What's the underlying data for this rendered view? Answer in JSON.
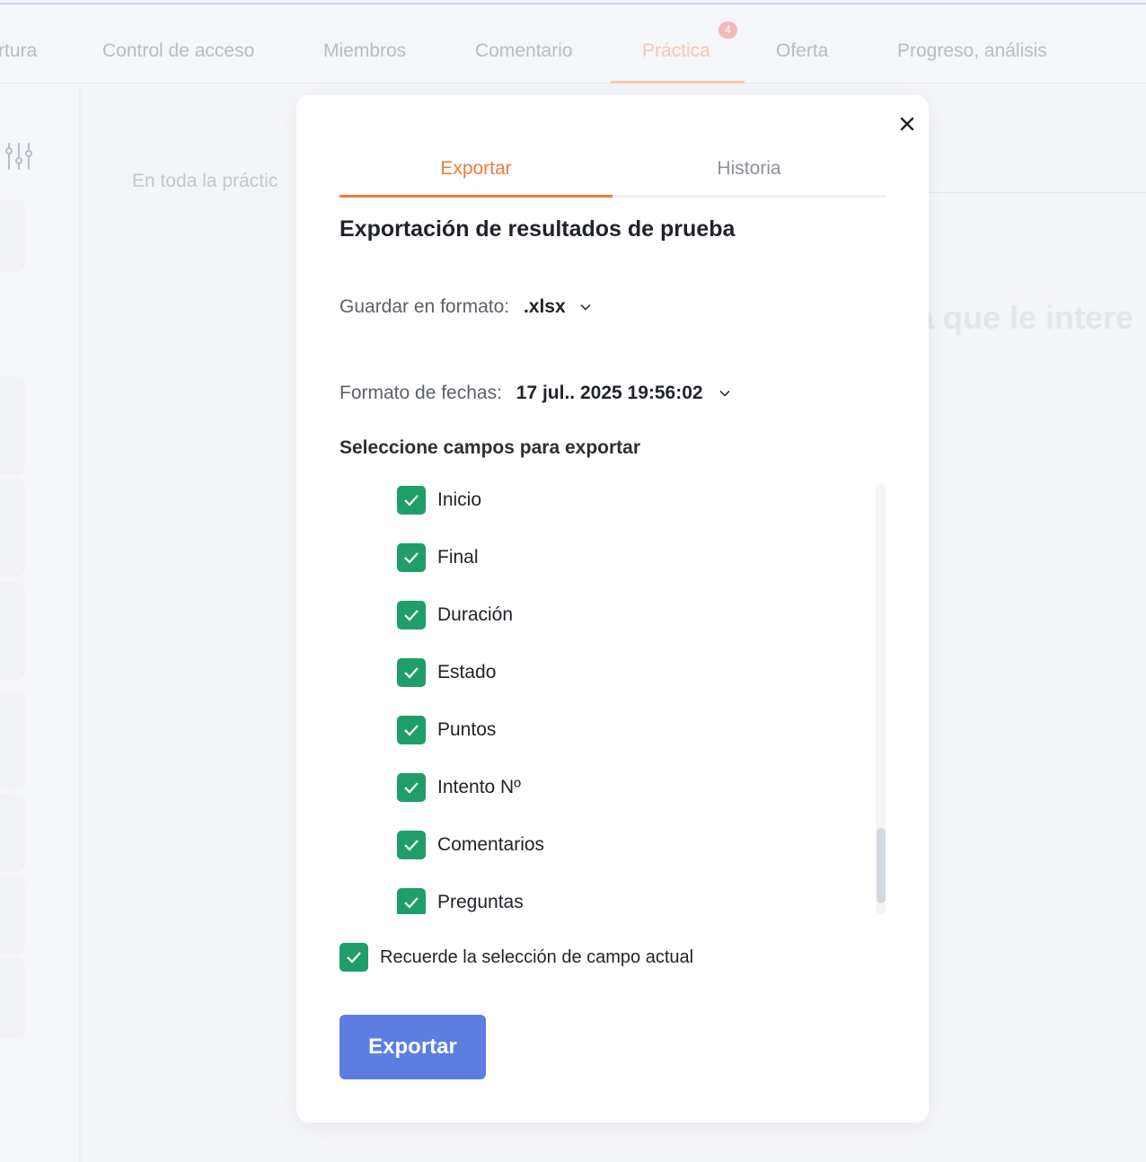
{
  "background": {
    "nav_tabs": [
      "rtura",
      "Control de acceso",
      "Miembros",
      "Comentario",
      "Práctica",
      "Oferta",
      "Progreso, análisis"
    ],
    "active_tab_badge": "4",
    "search_text": "En toda la práctic",
    "right_heading_text": "a que le intere"
  },
  "modal": {
    "tabs": [
      "Exportar",
      "Historia"
    ],
    "title": "Exportación de resultados de prueba",
    "save_format_label": "Guardar en formato:",
    "save_format_value": ".xlsx",
    "date_format_label": "Formato de fechas:",
    "date_format_value": "17 jul.. 2025 19:56:02",
    "fields_heading": "Seleccione campos para exportar",
    "fields": [
      {
        "label": "Inicio",
        "checked": true
      },
      {
        "label": "Final",
        "checked": true
      },
      {
        "label": "Duración",
        "checked": true
      },
      {
        "label": "Estado",
        "checked": true
      },
      {
        "label": "Puntos",
        "checked": true
      },
      {
        "label": "Intento Nº",
        "checked": true
      },
      {
        "label": "Comentarios",
        "checked": true
      },
      {
        "label": "Preguntas",
        "checked": true
      }
    ],
    "remember_label": "Recuerde la selección de campo actual",
    "remember_checked": true,
    "export_button": "Exportar"
  },
  "colors": {
    "accent_orange": "#f07a3e",
    "check_green": "#1f9e6a",
    "button_blue": "#5e7de0"
  },
  "icons": [
    "close-icon",
    "chevron-down-icon",
    "check-icon",
    "filter-sliders-icon"
  ]
}
